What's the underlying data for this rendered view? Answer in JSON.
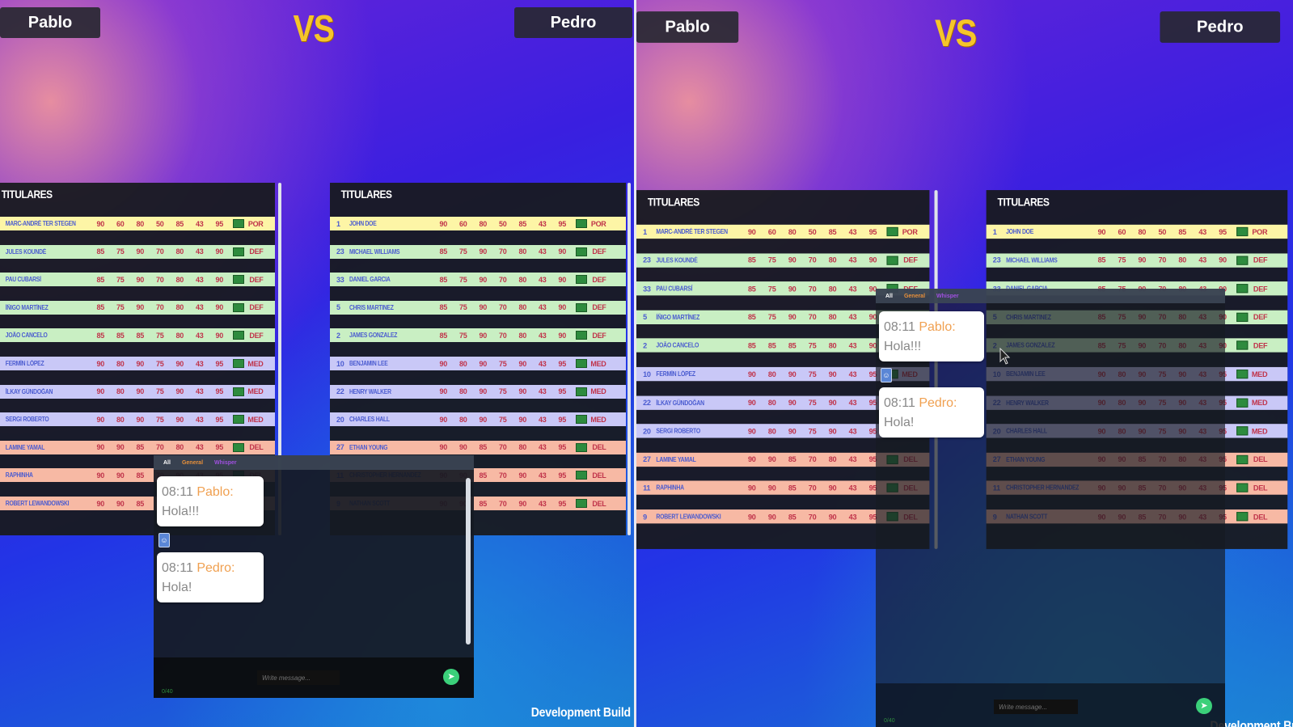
{
  "header": {
    "player1": "Pablo",
    "player2": "Pedro",
    "vs": "VS"
  },
  "section_title": "TITULARES",
  "team1": [
    {
      "num": "1",
      "name": "MARC-ANDRÉ TER STEGEN",
      "stats": [
        "90",
        "60",
        "80",
        "50",
        "85",
        "43",
        "95"
      ],
      "pos": "POR",
      "cls": "POR"
    },
    {
      "num": "23",
      "name": "JULES KOUNDÉ",
      "stats": [
        "85",
        "75",
        "90",
        "70",
        "80",
        "43",
        "90"
      ],
      "pos": "DEF",
      "cls": "DEF"
    },
    {
      "num": "33",
      "name": "PAU CUBARSÍ",
      "stats": [
        "85",
        "75",
        "90",
        "70",
        "80",
        "43",
        "90"
      ],
      "pos": "DEF",
      "cls": "DEF"
    },
    {
      "num": "5",
      "name": "ÍÑIGO MARTÍNEZ",
      "stats": [
        "85",
        "75",
        "90",
        "70",
        "80",
        "43",
        "90"
      ],
      "pos": "DEF",
      "cls": "DEF"
    },
    {
      "num": "2",
      "name": "JOÃO CANCELO",
      "stats": [
        "85",
        "85",
        "85",
        "75",
        "80",
        "43",
        "90"
      ],
      "pos": "DEF",
      "cls": "DEF"
    },
    {
      "num": "10",
      "name": "FERMÍN LÓPEZ",
      "stats": [
        "90",
        "80",
        "90",
        "75",
        "90",
        "43",
        "95"
      ],
      "pos": "MED",
      "cls": "MED"
    },
    {
      "num": "22",
      "name": "İLKAY GÜNDOĞAN",
      "stats": [
        "90",
        "80",
        "90",
        "75",
        "90",
        "43",
        "95"
      ],
      "pos": "MED",
      "cls": "MED"
    },
    {
      "num": "20",
      "name": "SERGI ROBERTO",
      "stats": [
        "90",
        "80",
        "90",
        "75",
        "90",
        "43",
        "95"
      ],
      "pos": "MED",
      "cls": "MED"
    },
    {
      "num": "27",
      "name": "LAMINE YAMAL",
      "stats": [
        "90",
        "90",
        "85",
        "70",
        "80",
        "43",
        "95"
      ],
      "pos": "DEL",
      "cls": "DEL"
    },
    {
      "num": "11",
      "name": "RAPHINHA",
      "stats": [
        "90",
        "90",
        "85",
        "70",
        "90",
        "43",
        "95"
      ],
      "pos": "DEL",
      "cls": "DEL"
    },
    {
      "num": "9",
      "name": "ROBERT LEWANDOWSKI",
      "stats": [
        "90",
        "90",
        "85",
        "70",
        "90",
        "43",
        "95"
      ],
      "pos": "DEL",
      "cls": "DEL"
    }
  ],
  "team2": [
    {
      "num": "1",
      "name": "JOHN DOE",
      "stats": [
        "90",
        "60",
        "80",
        "50",
        "85",
        "43",
        "95"
      ],
      "pos": "POR",
      "cls": "POR"
    },
    {
      "num": "23",
      "name": "MICHAEL WILLIAMS",
      "stats": [
        "85",
        "75",
        "90",
        "70",
        "80",
        "43",
        "90"
      ],
      "pos": "DEF",
      "cls": "DEF"
    },
    {
      "num": "33",
      "name": "DANIEL GARCIA",
      "stats": [
        "85",
        "75",
        "90",
        "70",
        "80",
        "43",
        "90"
      ],
      "pos": "DEF",
      "cls": "DEF"
    },
    {
      "num": "5",
      "name": "CHRIS MARTINEZ",
      "stats": [
        "85",
        "75",
        "90",
        "70",
        "80",
        "43",
        "90"
      ],
      "pos": "DEF",
      "cls": "DEF"
    },
    {
      "num": "2",
      "name": "JAMES GONZALEZ",
      "stats": [
        "85",
        "75",
        "90",
        "70",
        "80",
        "43",
        "90"
      ],
      "pos": "DEF",
      "cls": "DEF"
    },
    {
      "num": "10",
      "name": "BENJAMIN LEE",
      "stats": [
        "90",
        "80",
        "90",
        "75",
        "90",
        "43",
        "95"
      ],
      "pos": "MED",
      "cls": "MED"
    },
    {
      "num": "22",
      "name": "HENRY WALKER",
      "stats": [
        "90",
        "80",
        "90",
        "75",
        "90",
        "43",
        "95"
      ],
      "pos": "MED",
      "cls": "MED"
    },
    {
      "num": "20",
      "name": "CHARLES HALL",
      "stats": [
        "90",
        "80",
        "90",
        "75",
        "90",
        "43",
        "95"
      ],
      "pos": "MED",
      "cls": "MED"
    },
    {
      "num": "27",
      "name": "ETHAN YOUNG",
      "stats": [
        "90",
        "90",
        "85",
        "70",
        "80",
        "43",
        "95"
      ],
      "pos": "DEL",
      "cls": "DEL"
    },
    {
      "num": "11",
      "name": "CHRISTOPHER HERNANDEZ",
      "stats": [
        "90",
        "90",
        "85",
        "70",
        "90",
        "43",
        "95"
      ],
      "pos": "DEL",
      "cls": "DEL"
    },
    {
      "num": "9",
      "name": "NATHAN SCOTT",
      "stats": [
        "90",
        "90",
        "85",
        "70",
        "90",
        "43",
        "95"
      ],
      "pos": "DEL",
      "cls": "DEL"
    }
  ],
  "chat": {
    "tabs": [
      "All",
      "General",
      "Whisper"
    ],
    "messages": [
      {
        "time": "08:11",
        "sender": "Pablo:",
        "text": "Hola!!!"
      },
      {
        "time": "08:11",
        "sender": "Pedro:",
        "text": "Hola!"
      }
    ],
    "input_placeholder": "Write message...",
    "char_count": "0/40",
    "send_icon": "send-icon",
    "accent": "#3bd07a"
  },
  "footer": {
    "dev_build": "Development Build"
  },
  "colors": {
    "por": "#fdf5a6",
    "def": "#c9efc3",
    "med": "#c9c8f7",
    "del": "#f7b9a4",
    "vs": "#f5c52a"
  }
}
